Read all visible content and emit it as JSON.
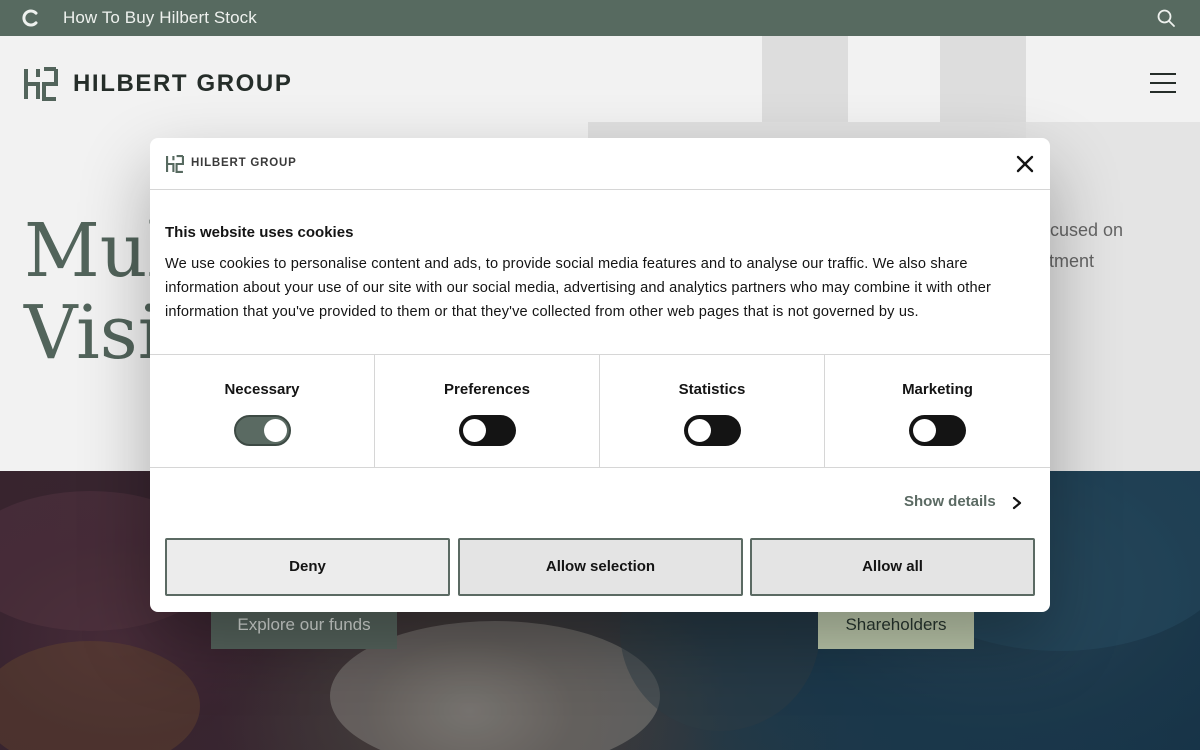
{
  "topbar": {
    "promo_text": "How To Buy Hilbert Stock",
    "background": "#576a60",
    "icons": [
      "loading-spinner-icon",
      "search-icon"
    ]
  },
  "header": {
    "brand": "HILBERT GROUP",
    "icons": [
      "hilbert-logo-icon",
      "hamburger-menu-icon"
    ]
  },
  "hero": {
    "headline_line1": "Mul",
    "headline_line2": "Visi",
    "lead_line1": "ocused on",
    "lead_line2": "stment"
  },
  "cta": {
    "funds_label": "Explore our funds",
    "shareholders_label": "Shareholders"
  },
  "cookie_dialog": {
    "brand": "HILBERT GROUP",
    "title": "This website uses cookies",
    "body": "We use cookies to personalise content and ads, to provide social media features and to analyse our traffic. We also share information about your use of our site with our social media, advertising and analytics partners who may combine it with other information that you've provided to them or that they've collected from other web pages that is not governed by us.",
    "categories": [
      {
        "label": "Necessary",
        "enabled": true
      },
      {
        "label": "Preferences",
        "enabled": false
      },
      {
        "label": "Statistics",
        "enabled": false
      },
      {
        "label": "Marketing",
        "enabled": false
      }
    ],
    "show_details": "Show details",
    "buttons": {
      "deny": "Deny",
      "allow_selection": "Allow selection",
      "allow_all": "Allow all"
    },
    "accent_color": "#5b6a63"
  }
}
